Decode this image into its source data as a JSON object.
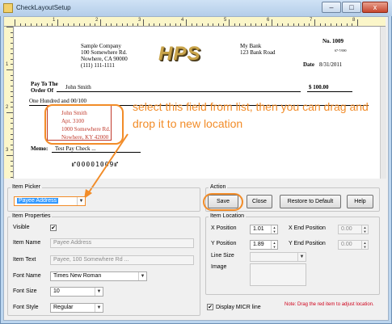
{
  "window": {
    "title": "CheckLayoutSetup",
    "minimize_glyph": "–",
    "maximize_glyph": "□",
    "close_glyph": "x"
  },
  "ruler": {
    "top_numbers": [
      "1",
      "2",
      "3",
      "4",
      "5",
      "6",
      "7",
      "8"
    ],
    "left_numbers": [
      "1",
      "2",
      "3"
    ]
  },
  "check": {
    "company": [
      "Sample Company",
      "100 Somewhere Rd.",
      "Nowhere, CA 90000",
      "(111) 111-1111"
    ],
    "logo": "HPS",
    "bank": [
      "My Bank",
      "123 Bank Road"
    ],
    "check_no": "No. 1009",
    "fraction": "67-7/690",
    "date_label": "Date",
    "date_value": "8/31/2011",
    "pay_to_label_1": "Pay To The",
    "pay_to_label_2": "Order Of",
    "payee_name": "John Smith",
    "amount": "$   100.00",
    "amount_words": "One Hundred  and 00/100",
    "payee_address": [
      "John Smith",
      "Apt. 3100",
      "1000 Somewhere Rd.",
      "Nowhere, KY 42000"
    ],
    "memo_label": "Memo:",
    "memo_value": "Test Pay Check ...",
    "micr": "⑈00001009⑈"
  },
  "callout": "select this field from list, then you can drag and drop it to new location",
  "item_picker": {
    "title": "Item Picker",
    "selected": "Payee Address"
  },
  "action": {
    "title": "Action",
    "save": "Save",
    "close": "Close",
    "restore": "Restore to Default",
    "help": "Help"
  },
  "item_properties": {
    "title": "Item Properties",
    "visible_label": "Visible",
    "visible_checked": "✔",
    "item_name_label": "Item Name",
    "item_name_value": "Payee Address",
    "item_text_label": "Item Text",
    "item_text_value": "Payee, 100 Somewhere Rd ...",
    "font_name_label": "Font Name",
    "font_name_value": "Times New Roman",
    "font_size_label": "Font Size",
    "font_size_value": "10",
    "font_style_label": "Font Style",
    "font_style_value": "Regular"
  },
  "item_location": {
    "title": "Item Location",
    "x_label": "X Position",
    "x_value": "1.01",
    "y_label": "Y Position",
    "y_value": "1.89",
    "x_end_label": "X End Position",
    "x_end_value": "0.00",
    "y_end_label": "Y End Position",
    "y_end_value": "0.00",
    "line_size_label": "Line Size",
    "image_label": "Image"
  },
  "display_micr": {
    "label": "Display MICR line",
    "checked": "✔"
  },
  "note": "Note:  Drag the red item to adjust location."
}
